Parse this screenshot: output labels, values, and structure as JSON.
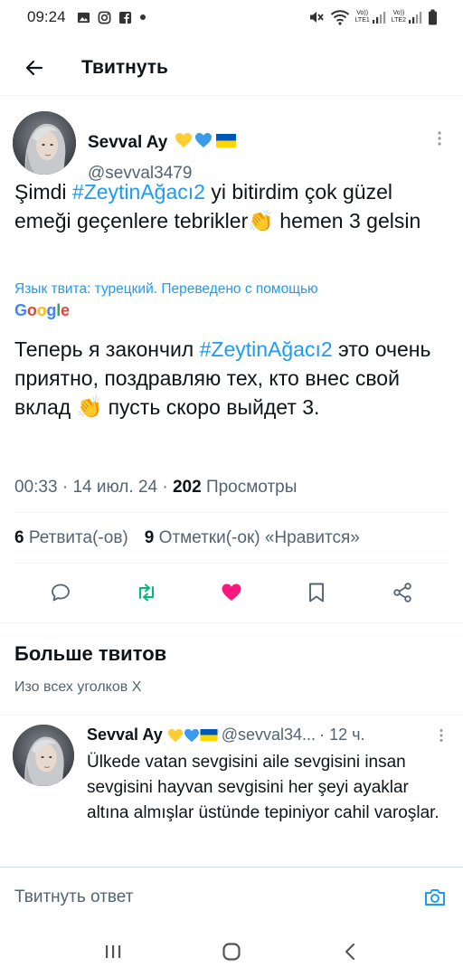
{
  "status_bar": {
    "time": "09:24",
    "sim1_label": "Vo)) LTE1",
    "sim2_label": "Vo)) LTE2",
    "sim1_top": "Vo))",
    "sim1_bottom": "LTE1",
    "sim2_top": "Vo))",
    "sim2_bottom": "LTE2"
  },
  "header": {
    "title": "Твитнуть"
  },
  "tweet": {
    "author_name": "Sevval Ay",
    "author_handle": "@sevval3479",
    "text_before": "Şimdi ",
    "hashtag": "#ZeytinAğacı2",
    "text_after": " yi bitirdim çok güzel emeği geçenlere tebrikler👏 hemen 3 gelsin",
    "translation_note": "Язык твита: турецкий. Переведено с помощью",
    "google_logo": "Google",
    "translated_before": "Теперь я закончил ",
    "translated_hashtag": "#ZeytinAğacı2",
    "translated_after": " это очень приятно, поздравляю тех, кто внес свой вклад 👏 пусть скоро выйдет 3.",
    "time": "00:33",
    "date": "14 июл. 24",
    "views_count": "202",
    "views_label": "Просмотры",
    "retweets_count": "6",
    "retweets_label": "Ретвита(-ов)",
    "likes_count": "9",
    "likes_label": "Отметки(-ок) «Нравится»",
    "liked": true
  },
  "more_tweets": {
    "title": "Больше твитов",
    "subtitle": "Изо всех уголков X",
    "items": [
      {
        "author_name": "Sevval Ay",
        "author_handle": "@sevval34...",
        "time": "12 ч.",
        "text": "Ülkede vatan sevgisini aile sevgisini insan sevgisini hayvan sevgisini her şeyi ayaklar altına almışlar üstünde tepiniyor cahil varoşlar."
      }
    ]
  },
  "reply": {
    "placeholder": "Твитнуть ответ"
  },
  "colors": {
    "accent": "#1d9bf0",
    "like": "#f91880",
    "retweet": "#00ba7c",
    "secondary_text": "#536471"
  }
}
